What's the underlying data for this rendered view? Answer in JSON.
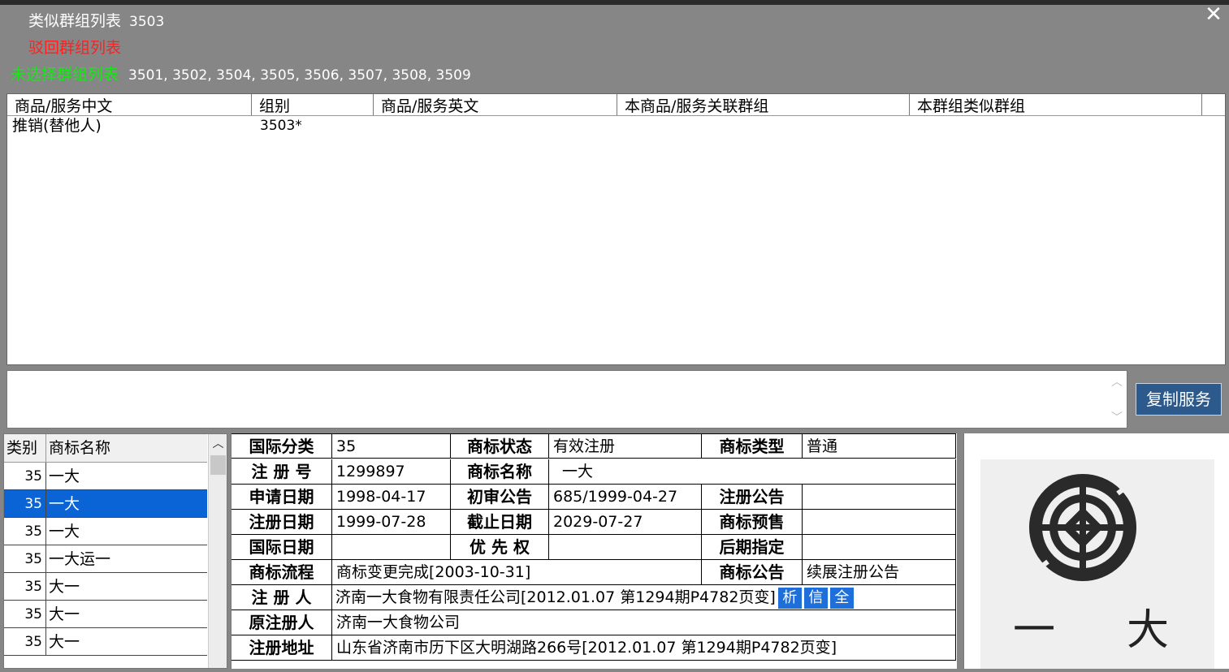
{
  "header": {
    "similar": {
      "label": "类似群组列表",
      "value": "3503",
      "color": "#ffffff"
    },
    "rejected": {
      "label": "驳回群组列表",
      "value": "",
      "color": "#ff2020"
    },
    "unselected": {
      "label": "未选择群组列表",
      "value": "3501, 3502, 3504, 3505, 3506, 3507, 3508, 3509",
      "color": "#19e619"
    },
    "close_icon": "close-icon"
  },
  "service_table": {
    "columns": [
      "商品/服务中文",
      "组别",
      "商品/服务英文",
      "本商品/服务关联群组",
      "本群组类似群组"
    ],
    "rows": [
      {
        "cn": "推销(替他人)",
        "group": "3503*",
        "en": "",
        "related": "",
        "similar": ""
      }
    ]
  },
  "service_text": {
    "value": ""
  },
  "copy_button": {
    "label": "复制服务"
  },
  "trademark_list": {
    "columns": [
      "类别",
      "商标名称"
    ],
    "rows": [
      {
        "cls": "35",
        "name": "一大",
        "selected": false
      },
      {
        "cls": "35",
        "name": "一大",
        "selected": true
      },
      {
        "cls": "35",
        "name": "一大",
        "selected": false
      },
      {
        "cls": "35",
        "name": "一大运一",
        "selected": false
      },
      {
        "cls": "35",
        "name": "大一",
        "selected": false
      },
      {
        "cls": "35",
        "name": "大一",
        "selected": false
      },
      {
        "cls": "35",
        "name": "大一",
        "selected": false
      }
    ]
  },
  "detail": {
    "intl_class": {
      "label": "国际分类",
      "value": "35"
    },
    "status": {
      "label": "商标状态",
      "value": "有效注册"
    },
    "type": {
      "label": "商标类型",
      "value": "普通"
    },
    "reg_no": {
      "label": "注 册 号",
      "value": "1299897"
    },
    "tm_name": {
      "label": "商标名称",
      "value": "一大"
    },
    "apply_date": {
      "label": "申请日期",
      "value": "1998-04-17"
    },
    "prelim": {
      "label": "初审公告",
      "value": "685/1999-04-27"
    },
    "reg_notice": {
      "label": "注册公告",
      "value": ""
    },
    "reg_date": {
      "label": "注册日期",
      "value": "1999-07-28"
    },
    "expire": {
      "label": "截止日期",
      "value": "2029-07-27"
    },
    "presale": {
      "label": "商标预售",
      "value": ""
    },
    "intl_date": {
      "label": "国际日期",
      "value": ""
    },
    "priority": {
      "label": "优 先 权",
      "value": ""
    },
    "later": {
      "label": "后期指定",
      "value": ""
    },
    "flow": {
      "label": "商标流程",
      "value": "商标变更完成[2003-10-31]"
    },
    "tm_notice": {
      "label": "商标公告",
      "value": "续展注册公告"
    },
    "registrant": {
      "label": "注 册 人",
      "value": "济南一大食物有限责任公司[2012.01.07 第1294期P4782页变]"
    },
    "chips": [
      "析",
      "信",
      "全"
    ],
    "orig_registrant": {
      "label": "原注册人",
      "value": "济南一大食物公司"
    },
    "address": {
      "label": "注册地址",
      "value": "山东省济南市历下区大明湖路266号[2012.01.07 第1294期P4782页变]"
    }
  },
  "logo": {
    "chars": [
      "一",
      "大"
    ]
  }
}
